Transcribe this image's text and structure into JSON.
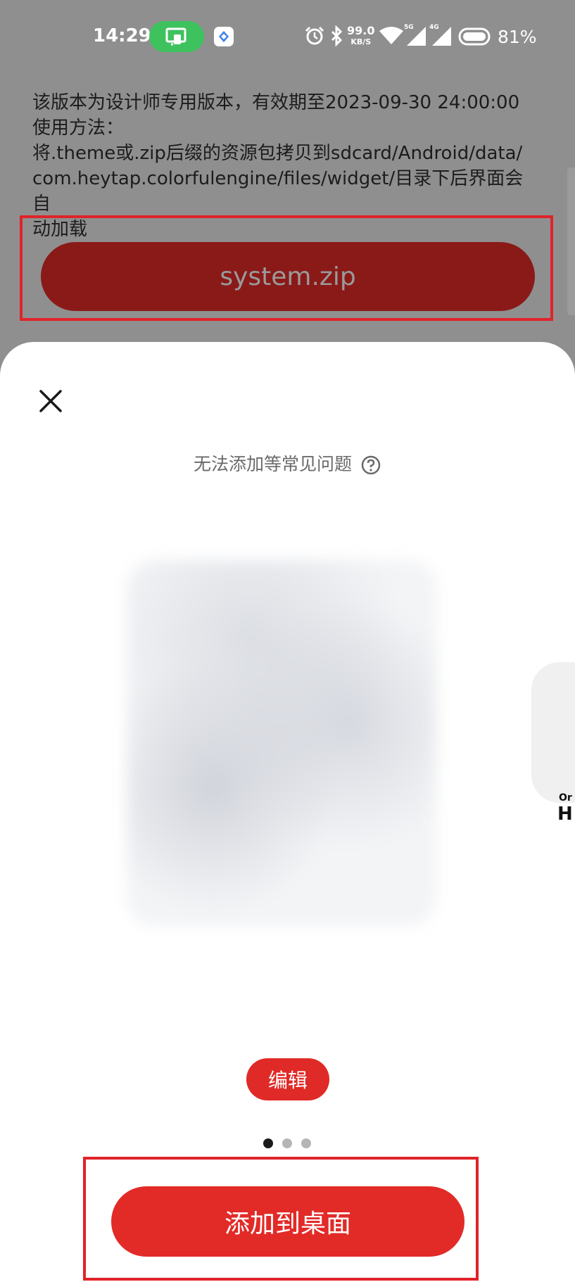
{
  "status_bar": {
    "time": "14:29",
    "net_speed_value": "99.0",
    "net_speed_unit": "KB/S",
    "signal_5g": "5G",
    "signal_4g": "4G",
    "battery_percent": "81%"
  },
  "instructions": {
    "line1": "该版本为设计师专用版本，有效期至2023-09-30 24:00:00",
    "line2": "使用方法：",
    "line3": "将.theme或.zip后缀的资源包拷贝到sdcard/Android/data/",
    "line4": "com.heytap.colorfulengine/files/widget/目录下后界面会自",
    "line5": "动加载"
  },
  "file_button": {
    "label": "system.zip"
  },
  "sheet": {
    "faq_text": "无法添加等常见问题",
    "next_card_text_small": "Or",
    "next_card_text_large": "H",
    "edit_label": "编辑",
    "page_indicator": {
      "total": 3,
      "active": 0
    },
    "add_button_label": "添加到桌面"
  },
  "colors": {
    "accent_red": "#e22a27",
    "file_button_bg": "#8a1a18",
    "highlight_border": "#e0232a",
    "cast_pill_green": "#3ec25e"
  },
  "icons": [
    "screen-cast-icon",
    "app-badge-icon",
    "alarm-icon",
    "bluetooth-icon",
    "wifi-icon",
    "cellular-signal-icon",
    "battery-icon",
    "close-icon",
    "help-icon"
  ]
}
